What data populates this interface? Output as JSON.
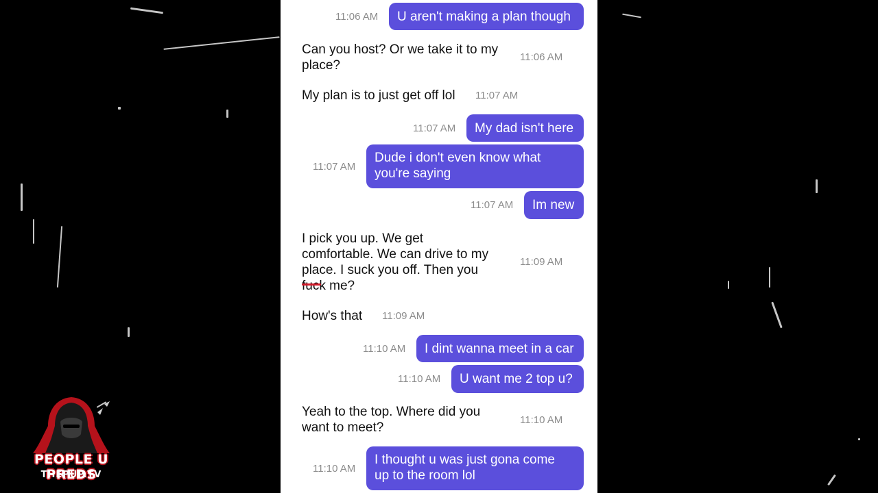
{
  "conversation": {
    "messages": [
      {
        "direction": "outgoing",
        "text": "U aren't making a plan though",
        "time": "11:06 AM"
      },
      {
        "direction": "incoming",
        "text": "Can you host? Or we take it to my\nplace?",
        "time": "11:06 AM"
      },
      {
        "direction": "incoming",
        "text": "My plan is to just get off lol",
        "time": "11:07 AM"
      },
      {
        "direction": "outgoing",
        "text": "My dad isn't here",
        "time": "11:07 AM"
      },
      {
        "direction": "outgoing",
        "text": "Dude i don't even know what\nyou're saying",
        "time": "11:07 AM"
      },
      {
        "direction": "outgoing",
        "text": "Im new",
        "time": "11:07 AM"
      },
      {
        "direction": "incoming",
        "text": "I pick you up. We get\ncomfortable. We can drive to my\nplace. I suck you off. Then you\nfuck me?",
        "time": "11:09 AM",
        "redacted_word": true
      },
      {
        "direction": "incoming",
        "text": "How's that",
        "time": "11:09 AM"
      },
      {
        "direction": "outgoing",
        "text": "I dint wanna meet in a car",
        "time": "11:10 AM"
      },
      {
        "direction": "outgoing",
        "text": "U want me 2 top u?",
        "time": "11:10 AM"
      },
      {
        "direction": "incoming",
        "text": "Yeah to the top. Where did you\nwant to meet?",
        "time": "11:10 AM"
      },
      {
        "direction": "outgoing",
        "text": "I thought u was just gona come\nup to the room lol",
        "time": "11:10 AM"
      }
    ]
  },
  "watermark": {
    "title": "PEOPLE U PREDS",
    "subtitle": "THEPUP.TV",
    "icon": "hooded-figure-icon"
  },
  "colors": {
    "outgoing_bubble": "#5b4fdc",
    "background": "#000000",
    "chat_background": "#ffffff",
    "timestamp": "#8c8c8c",
    "logo_accent": "#b5121b"
  }
}
